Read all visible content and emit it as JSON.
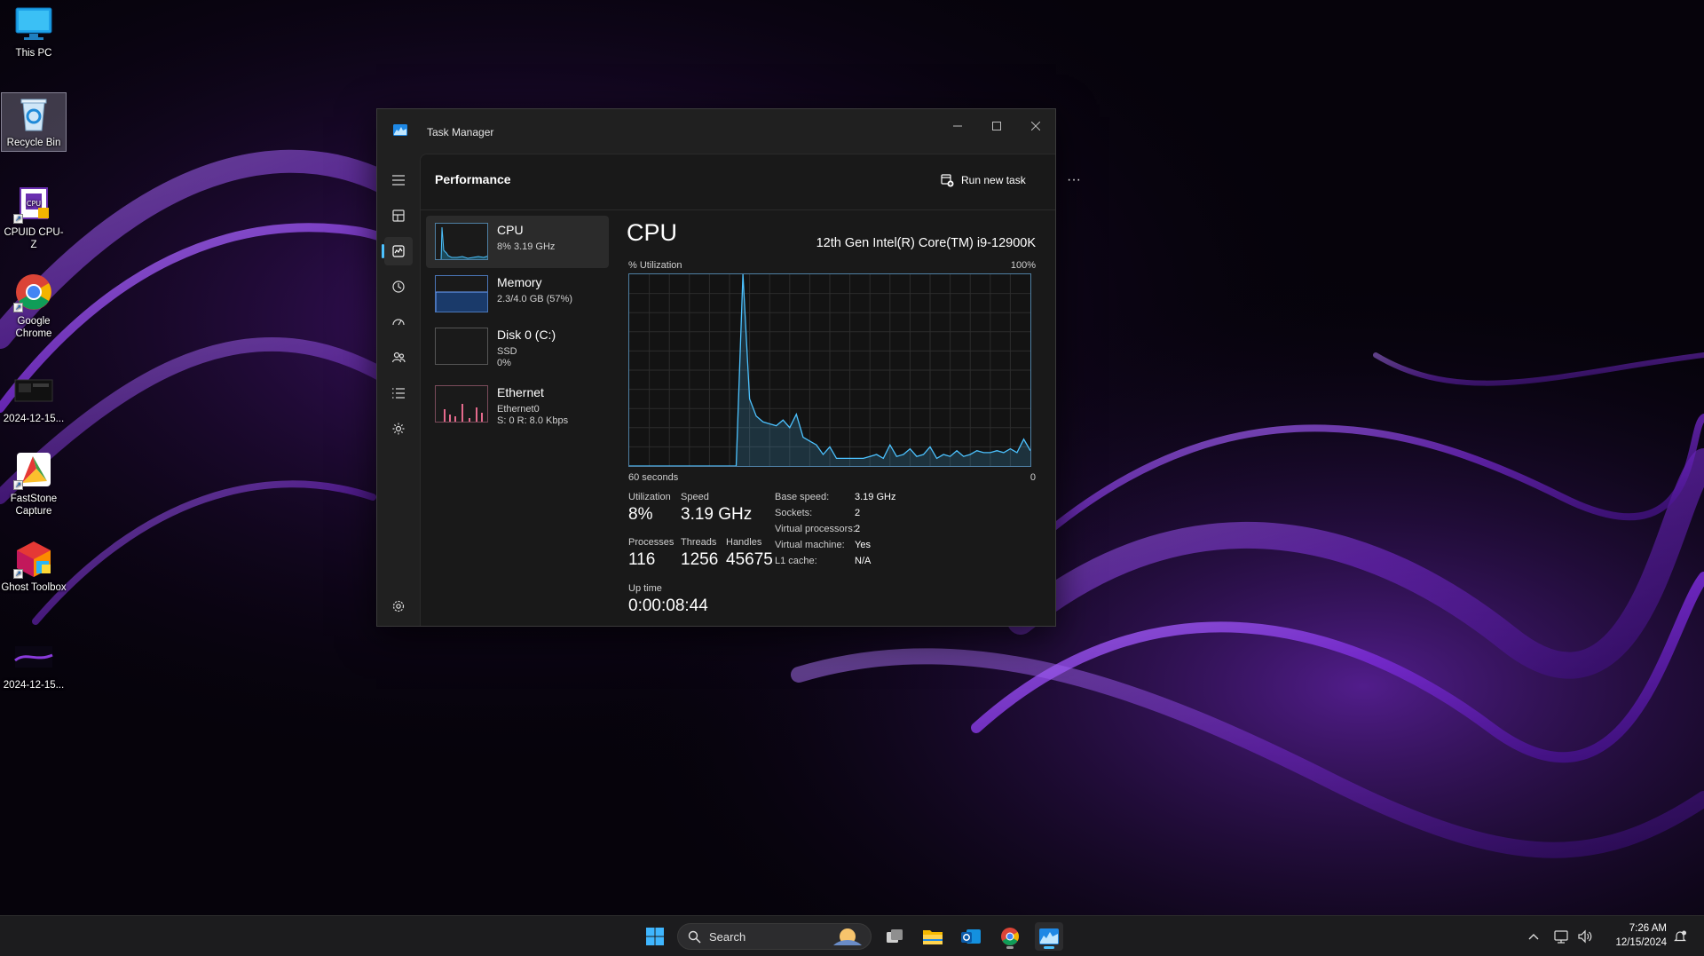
{
  "desktop": {
    "icons": [
      {
        "label": "This PC"
      },
      {
        "label": "Recycle Bin"
      },
      {
        "label": "CPUID CPU-Z"
      },
      {
        "label": "Google Chrome"
      },
      {
        "label": "2024-12-15..."
      },
      {
        "label": "FastStone Capture"
      },
      {
        "label": "Ghost Toolbox"
      },
      {
        "label": "2024-12-15..."
      }
    ]
  },
  "window": {
    "title": "Task Manager",
    "page_title": "Performance",
    "run_new_task": "Run new task",
    "more": "···"
  },
  "perf_list": [
    {
      "name": "CPU",
      "line1": "8%  3.19 GHz"
    },
    {
      "name": "Memory",
      "line1": "2.3/4.0 GB (57%)",
      "usage_fraction": 0.57
    },
    {
      "name": "Disk 0 (C:)",
      "line1": "SSD",
      "line2": "0%"
    },
    {
      "name": "Ethernet",
      "line1": "Ethernet0",
      "line2": "S: 0  R: 8.0 Kbps"
    }
  ],
  "cpu": {
    "title": "CPU",
    "model": "12th Gen Intel(R) Core(TM) i9-12900K",
    "util_axis_label": "% Utilization",
    "util_max_label": "100%",
    "time_left_label": "60 seconds",
    "time_right_label": "0",
    "stats": {
      "utilization_label": "Utilization",
      "utilization": "8%",
      "speed_label": "Speed",
      "speed": "3.19 GHz",
      "processes_label": "Processes",
      "processes": "116",
      "threads_label": "Threads",
      "threads": "1256",
      "handles_label": "Handles",
      "handles": "45675",
      "uptime_label": "Up time",
      "uptime": "0:00:08:44"
    },
    "specs": [
      {
        "key": "Base speed:",
        "value": "3.19 GHz"
      },
      {
        "key": "Sockets:",
        "value": "2"
      },
      {
        "key": "Virtual processors:",
        "value": "2"
      },
      {
        "key": "Virtual machine:",
        "value": "Yes"
      },
      {
        "key": "L1 cache:",
        "value": "N/A"
      }
    ]
  },
  "chart_data": {
    "type": "area",
    "title": "",
    "xlabel": "",
    "ylabel": "% Utilization",
    "xlim": [
      60,
      0
    ],
    "ylim": [
      0,
      100
    ],
    "series": [
      {
        "x": [
          60,
          57,
          56,
          55,
          54,
          53,
          52,
          51,
          50,
          49,
          48,
          47,
          46,
          45,
          44,
          43,
          42,
          41,
          40,
          39,
          38,
          37,
          36,
          35,
          34,
          33,
          32,
          31,
          30,
          29,
          28,
          27,
          26,
          25,
          24,
          23,
          22,
          21,
          20,
          19,
          18,
          17,
          16,
          15,
          14,
          13,
          12,
          11,
          10,
          9,
          8,
          7,
          6,
          5,
          4,
          3,
          2,
          1,
          0
        ],
        "values": [
          0,
          0,
          0,
          0,
          0,
          0,
          0,
          0,
          0,
          0,
          0,
          0,
          0,
          0,
          0,
          100,
          35,
          26,
          23,
          22,
          21,
          24,
          20,
          27,
          15,
          13,
          11,
          6,
          10,
          4,
          4,
          4,
          4,
          4,
          5,
          6,
          4,
          11,
          5,
          6,
          9,
          5,
          6,
          10,
          4,
          6,
          5,
          8,
          5,
          6,
          8,
          7,
          7,
          8,
          7,
          9,
          7,
          14,
          8
        ]
      }
    ],
    "grid": true,
    "color": "#4cc2ff"
  },
  "taskbar": {
    "search_placeholder": "Search",
    "time": "7:26 AM",
    "date": "12/15/2024"
  },
  "colors": {
    "accent": "#4cc2ff",
    "graph_border": "#4e7fa3",
    "ethernet_spike": "#e46a8c"
  }
}
